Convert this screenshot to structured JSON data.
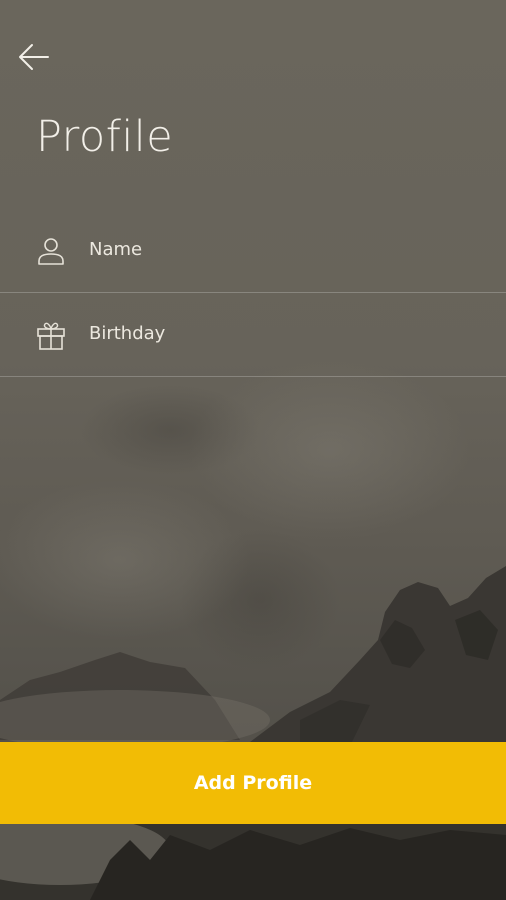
{
  "header": {
    "back_icon": "arrow-left-icon",
    "title": "Profile"
  },
  "fields": [
    {
      "icon": "person-icon",
      "label": "Name"
    },
    {
      "icon": "gift-icon",
      "label": "Birthday"
    }
  ],
  "primary_action": {
    "label": "Add Profile",
    "color": "#f2bc05"
  }
}
